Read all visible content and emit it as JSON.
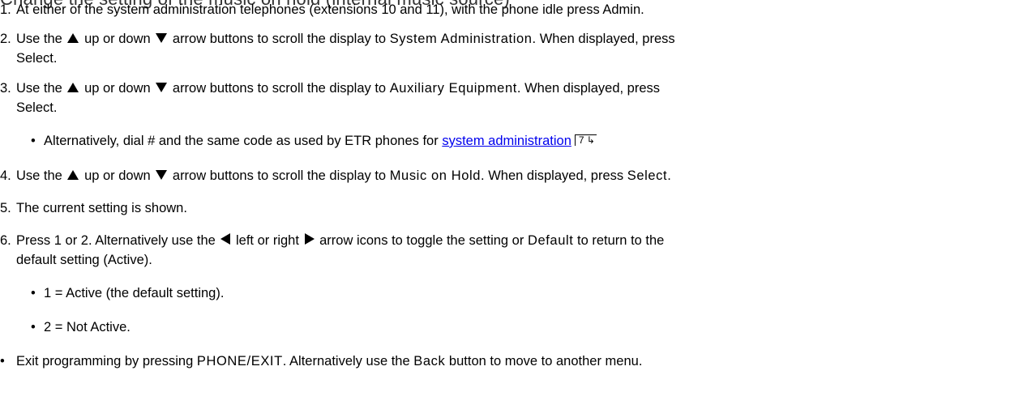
{
  "heading_cut": "Change the setting of the music on hold (internal music source)",
  "steps": [
    {
      "num": "1.",
      "text": "At either of the system administration telephones (extensions 10 and 11), with the phone idle press Admin."
    },
    {
      "num": "2.",
      "a": "Use the",
      "b": "up or down",
      "c": "arrow buttons to scroll the display to",
      "d": "System Administration",
      "e": ". When displayed, press",
      "f": "Select."
    },
    {
      "num": "3.",
      "a": "Use the",
      "b": "up or down",
      "c": "arrow buttons to scroll the display to",
      "d": "Auxiliary Equipment",
      "e": ". When displayed, press",
      "f": "Select."
    },
    {
      "num": "4.",
      "a": "Use the",
      "b": "up or down",
      "c": "arrow buttons to scroll the display to",
      "d": "Music on Hold",
      "e": ". When displayed, press",
      "f": "Select."
    },
    {
      "num": "5.",
      "text": "The current setting is shown."
    },
    {
      "num": "6.",
      "a": "Press 1 or 2. Alternatively use the",
      "b": "left or right",
      "c": "arrow icons to toggle the setting or",
      "d": "Default",
      "e": "to return to the",
      "f": "default setting (Active)."
    }
  ],
  "step3_bullet": {
    "text": "Alternatively, dial # and the same code as used by ETR phones for",
    "link": "system administration",
    "page_ref": "7"
  },
  "step6_bullets": [
    "1 = Active (the default setting).",
    "2 = Not Active."
  ],
  "final_bullet": {
    "a": "Exit programming by pressing",
    "b": "PHONE/EXIT",
    "c": ". Alternatively use the",
    "d": "Back",
    "e": "button to move to another menu."
  },
  "colors": {
    "link": "#0000ee",
    "text": "#000000"
  }
}
